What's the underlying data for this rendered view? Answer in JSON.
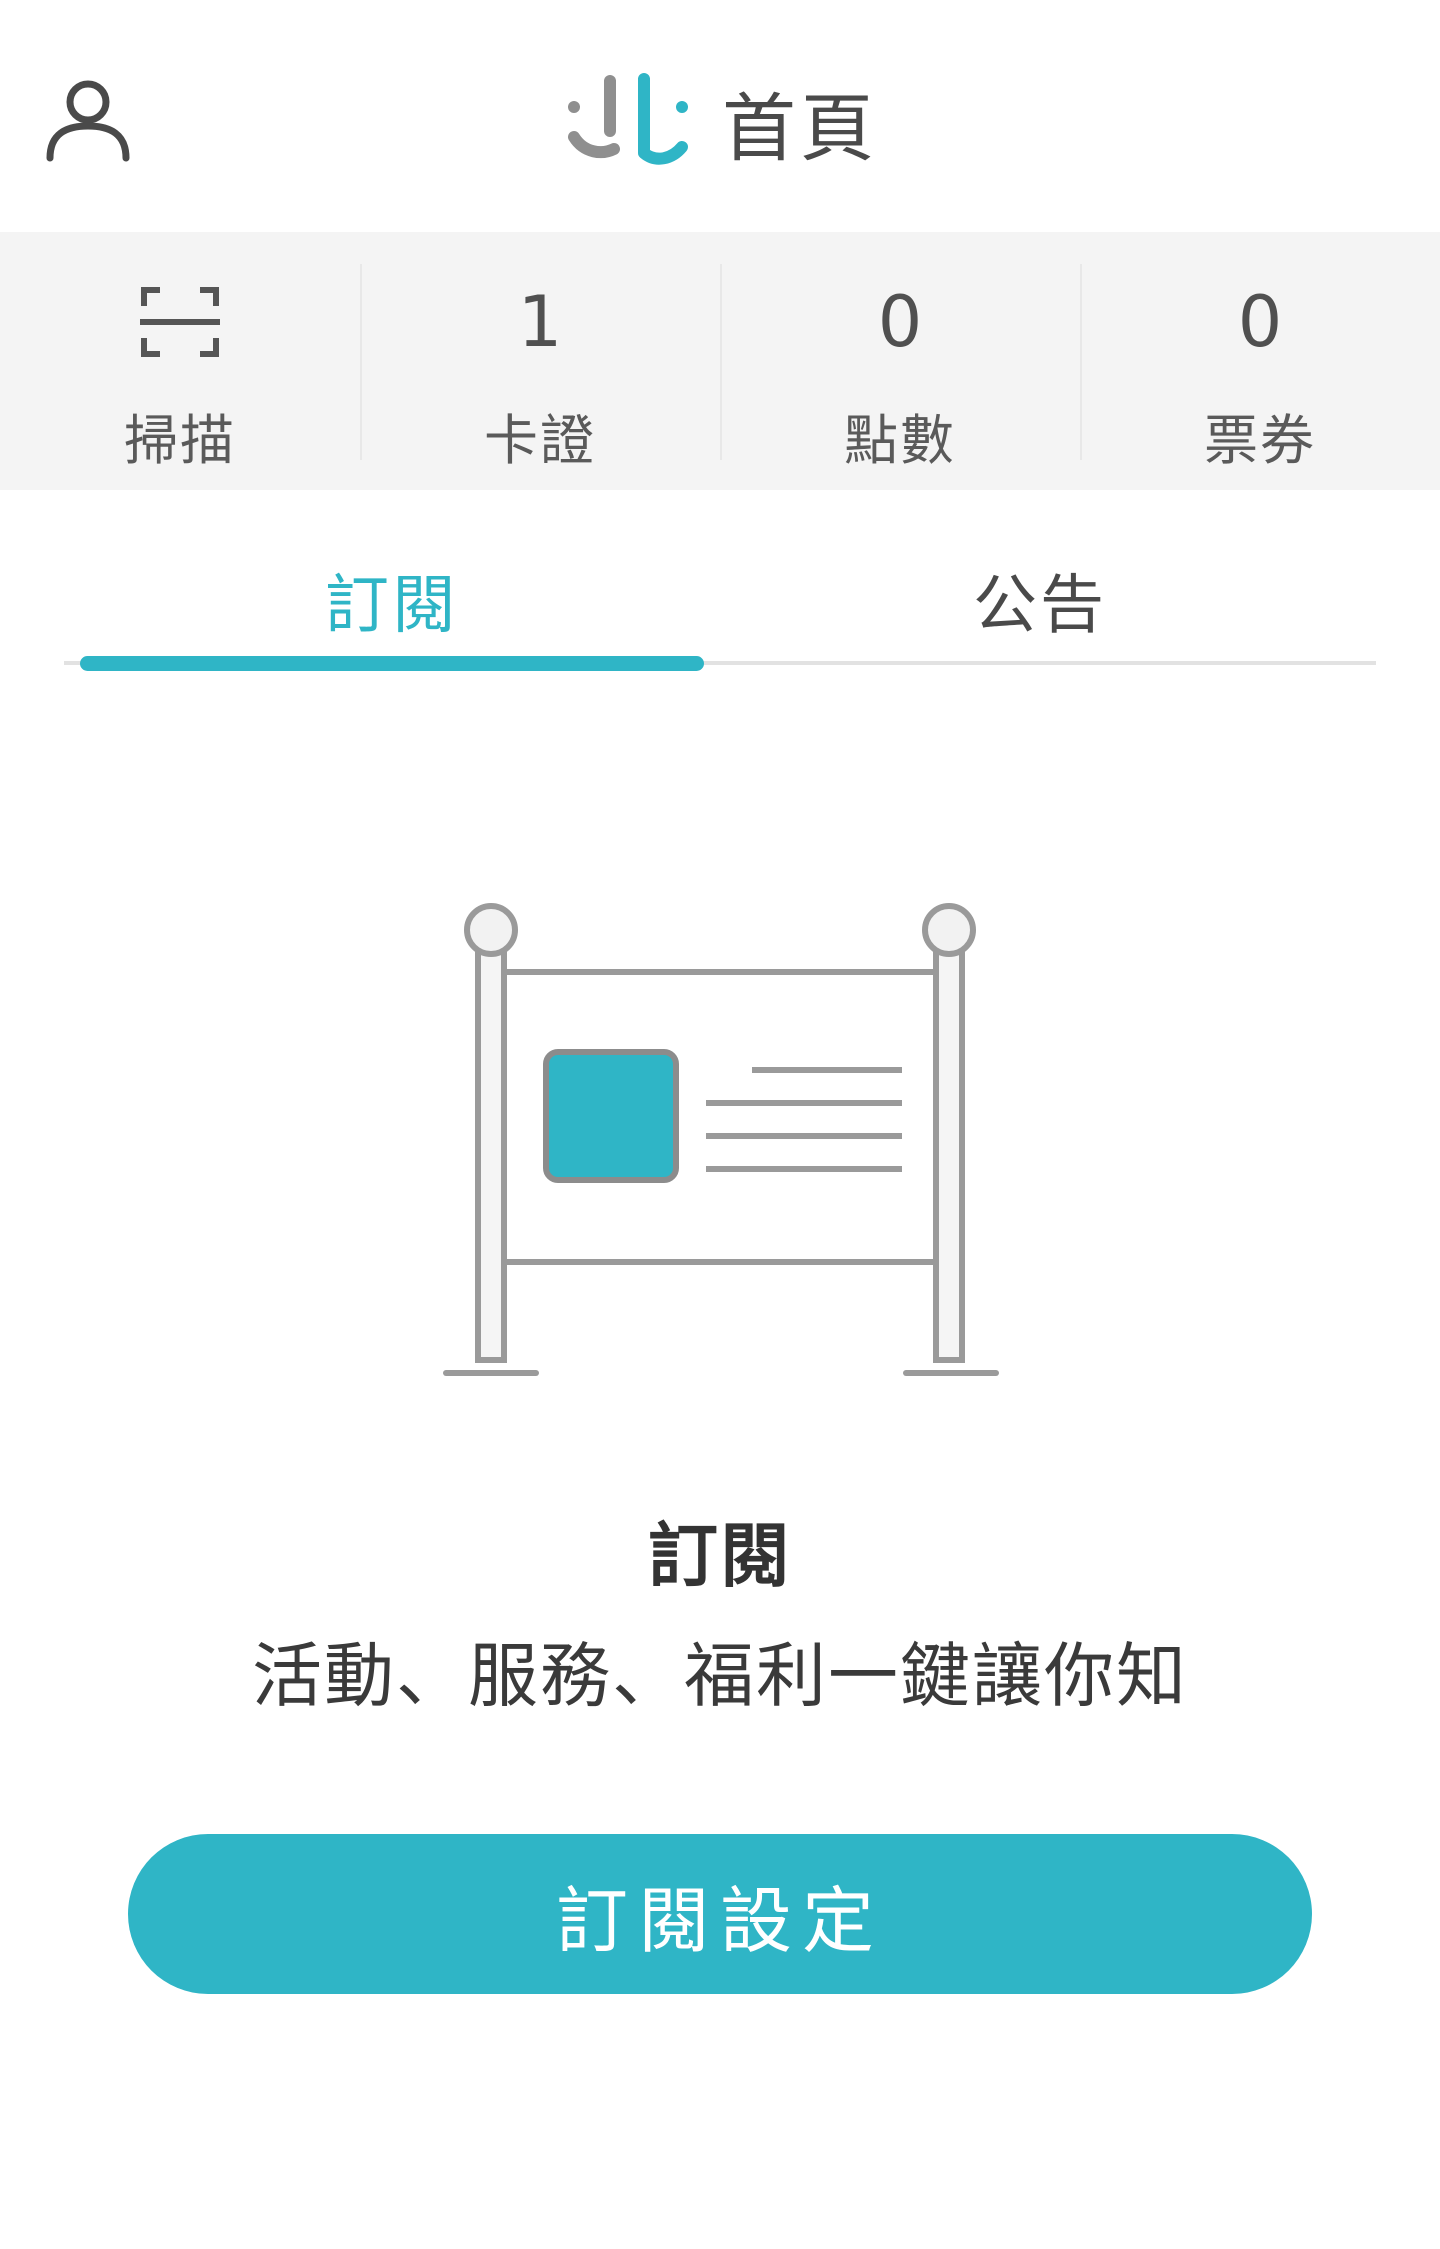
{
  "header": {
    "title": "首頁",
    "profile_icon": "user-icon",
    "logo_icon": "app-logo"
  },
  "stats": [
    {
      "icon": "scan-icon",
      "label": "掃描"
    },
    {
      "value": "1",
      "label": "卡證"
    },
    {
      "value": "0",
      "label": "點數"
    },
    {
      "value": "0",
      "label": "票券"
    }
  ],
  "tabs": [
    {
      "label": "訂閱",
      "active": true
    },
    {
      "label": "公告",
      "active": false
    }
  ],
  "empty_state": {
    "illustration": "bulletin-board-illustration",
    "title": "訂閱",
    "description": "活動、服務、福利一鍵讓你知"
  },
  "cta": {
    "label": "訂閱設定"
  },
  "colors": {
    "accent": "#2fb5c6",
    "stats_background": "#f4f4f4",
    "text": "#4a4a4a"
  }
}
